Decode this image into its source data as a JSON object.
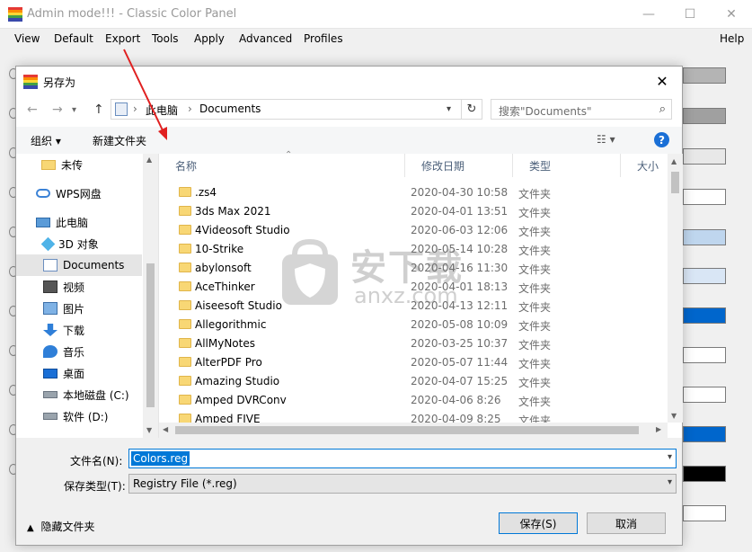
{
  "app": {
    "title": "Admin mode!!! - Classic Color Panel",
    "menu": [
      "View",
      "Default",
      "Export",
      "Tools",
      "Apply",
      "Advanced",
      "Profiles"
    ],
    "help": "Help",
    "swatch_colors": [
      "#b4b4b4",
      "#a0a0a0",
      "#e8e8e8",
      "#ffffff",
      "#bfd6ee",
      "#d9e6f5",
      "#0066cc",
      "#ffffff",
      "#ffffff",
      "#0066cc",
      "#c8c8c8",
      "#ffffff",
      "#000000"
    ]
  },
  "dialog": {
    "title": "另存为",
    "close": "✕",
    "breadcrumb": [
      "此电脑",
      "Documents"
    ],
    "search_placeholder": "搜索\"Documents\"",
    "toolbar": {
      "organize": "组织 ▾",
      "new_folder": "新建文件夹"
    },
    "nav_items": [
      {
        "label": "未传",
        "icon": "folder-icon"
      },
      {
        "label": "WPS网盘",
        "icon": "cloud-icon"
      },
      {
        "label": "此电脑",
        "icon": "computer-icon"
      },
      {
        "label": "3D 对象",
        "icon": "3d-objects-icon"
      },
      {
        "label": "Documents",
        "icon": "documents-icon"
      },
      {
        "label": "视频",
        "icon": "video-icon"
      },
      {
        "label": "图片",
        "icon": "pictures-icon"
      },
      {
        "label": "下载",
        "icon": "download-icon"
      },
      {
        "label": "音乐",
        "icon": "music-icon"
      },
      {
        "label": "桌面",
        "icon": "desktop-icon"
      },
      {
        "label": "本地磁盘 (C:)",
        "icon": "drive-icon"
      },
      {
        "label": "软件 (D:)",
        "icon": "drive-icon"
      }
    ],
    "columns": {
      "name": "名称",
      "date": "修改日期",
      "type": "类型",
      "size": "大小"
    },
    "files": [
      {
        "name": ".zs4",
        "date": "2020-04-30 10:58",
        "type": "文件夹"
      },
      {
        "name": "3ds Max 2021",
        "date": "2020-04-01 13:51",
        "type": "文件夹"
      },
      {
        "name": "4Videosoft Studio",
        "date": "2020-06-03 12:06",
        "type": "文件夹"
      },
      {
        "name": "10-Strike",
        "date": "2020-05-14 10:28",
        "type": "文件夹"
      },
      {
        "name": "abylonsoft",
        "date": "2020-04-16 11:30",
        "type": "文件夹"
      },
      {
        "name": "AceThinker",
        "date": "2020-04-01 18:13",
        "type": "文件夹"
      },
      {
        "name": "Aiseesoft Studio",
        "date": "2020-04-13 12:11",
        "type": "文件夹"
      },
      {
        "name": "Allegorithmic",
        "date": "2020-05-08 10:09",
        "type": "文件夹"
      },
      {
        "name": "AllMyNotes",
        "date": "2020-03-25 10:37",
        "type": "文件夹"
      },
      {
        "name": "AlterPDF Pro",
        "date": "2020-05-07 11:44",
        "type": "文件夹"
      },
      {
        "name": "Amazing Studio",
        "date": "2020-04-07 15:25",
        "type": "文件夹"
      },
      {
        "name": "Amped DVRConv",
        "date": "2020-04-06 8:26",
        "type": "文件夹"
      },
      {
        "name": "Amped FIVE",
        "date": "2020-04-09 8:25",
        "type": "文件夹"
      }
    ],
    "filename_label": "文件名(N):",
    "filename_value": "Colors.reg",
    "filetype_label": "保存类型(T):",
    "filetype_value": "Registry File (*.reg)",
    "hide_folders": "隐藏文件夹",
    "save_button": "保存(S)",
    "cancel_button": "取消"
  },
  "watermark": {
    "text": "安下载",
    "subtext": "anxz.com"
  }
}
